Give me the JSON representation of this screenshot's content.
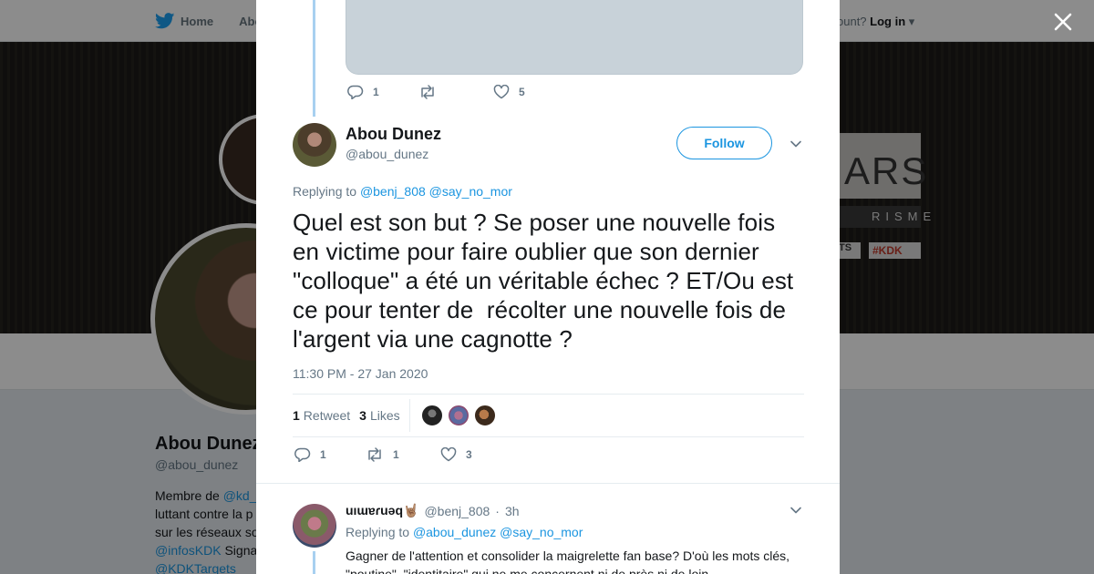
{
  "background_page": {
    "nav": {
      "home_label": "Home",
      "second_label": "Abo"
    },
    "login": {
      "prefix": "ccount?",
      "login_label": "Log in"
    },
    "banner": {
      "title_fragment": "ARS",
      "subtitle_fragment": "RISME",
      "tag1": "TS",
      "tag2": "#KDK"
    },
    "profile": {
      "name": "Abou Dunez",
      "handle": "@abou_dunez",
      "bio_line1_prefix": "Membre de ",
      "bio_line1_link": "@kd_",
      "bio_line2": "luttant contre la p",
      "bio_line3": "sur les réseaux so",
      "bio_line4_link": "@infosKDK",
      "bio_line4_suffix": " Signa",
      "bio_line5_link": "@KDKTargets"
    }
  },
  "close": {
    "icon": "close-icon"
  },
  "previous_tweet": {
    "replies": "1",
    "retweets": "",
    "likes": "5"
  },
  "tweet": {
    "author_name": "Abou Dunez",
    "author_handle": "@abou_dunez",
    "follow_label": "Follow",
    "replying_prefix": "Replying to ",
    "replying_to": [
      "@benj_808",
      "@say_no_mor"
    ],
    "text": "Quel est son but ? Se poser une nouvelle fois en victime pour faire oublier que son dernier \"colloque\" a été un véritable échec ? ET/Ou est ce pour tenter de  récolter une nouvelle fois de l'argent via une cagnotte ?",
    "timestamp": "11:30 PM - 27 Jan 2020",
    "retweet_count": "1",
    "retweet_label": "Retweet",
    "like_count": "3",
    "like_label": "Likes",
    "actions": {
      "replies": "1",
      "retweets": "1",
      "likes": "3"
    }
  },
  "reply": {
    "name": "uıɯɐɾuǝq🤘🏽",
    "handle": "@benj_808",
    "separator": "·",
    "time": "3h",
    "replying_prefix": "Replying to ",
    "replying_to": [
      "@abou_dunez",
      "@say_no_mor"
    ],
    "text": "Gagner de l'attention et consolider la maigrelette fan base? D'où les mots clés, \"poutine\", \"identitaire\" qui ne me concernent ni de près ni de loin"
  },
  "colors": {
    "accent": "#1b95e0",
    "text": "#14171a",
    "muted": "#657786",
    "thread_line": "#a8d0f0"
  }
}
